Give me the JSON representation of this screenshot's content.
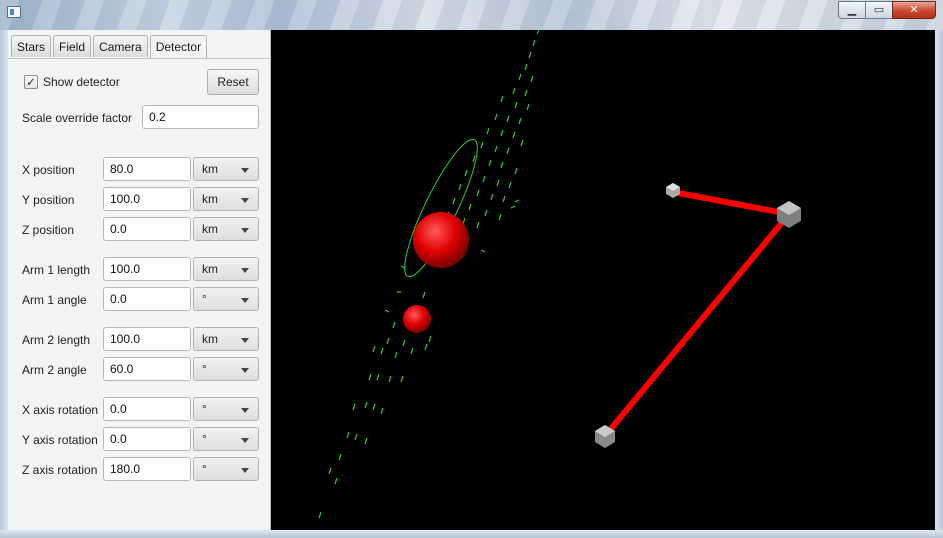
{
  "window": {
    "buttons": {
      "minimize": "▁",
      "maximize": "▭",
      "close": "✕"
    }
  },
  "tabs": [
    "Stars",
    "Field",
    "Camera",
    "Detector"
  ],
  "active_tab": "Detector",
  "detector": {
    "show_detector_label": "Show detector",
    "show_detector_checked": true,
    "checkmark": "✓",
    "reset_label": "Reset",
    "scale_override_label": "Scale override factor",
    "scale_override_value": "0.2",
    "rows": [
      {
        "label": "X position",
        "value": "80.0",
        "unit": "km"
      },
      {
        "label": "Y position",
        "value": "100.0",
        "unit": "km"
      },
      {
        "label": "Z position",
        "value": "0.0",
        "unit": "km"
      },
      {
        "label": "Arm 1 length",
        "value": "100.0",
        "unit": "km"
      },
      {
        "label": "Arm 1 angle",
        "value": "0.0",
        "unit": "°"
      },
      {
        "label": "Arm 2 length",
        "value": "100.0",
        "unit": "km"
      },
      {
        "label": "Arm 2 angle",
        "value": "60.0",
        "unit": "°"
      },
      {
        "label": "X axis rotation",
        "value": "0.0",
        "unit": "°"
      },
      {
        "label": "Y axis rotation",
        "value": "0.0",
        "unit": "°"
      },
      {
        "label": "Z axis rotation",
        "value": "180.0",
        "unit": "°"
      }
    ]
  },
  "scene": {
    "background": "#000000",
    "field_color": "#2ec82e",
    "star_color": "#e00000",
    "arm_color": "#ff0000",
    "node_color": "#8c8c8c"
  }
}
